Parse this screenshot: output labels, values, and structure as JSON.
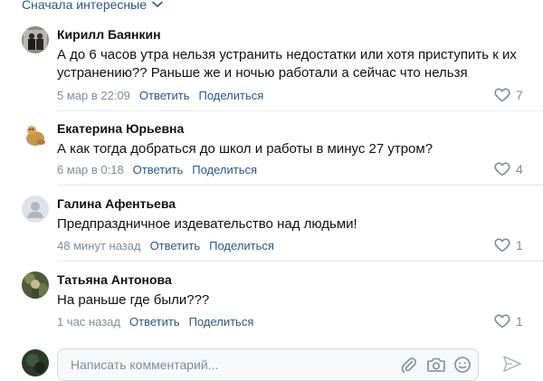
{
  "sort": {
    "label": "Сначала интересные"
  },
  "comments": [
    {
      "author": "Кирилл Баянкин",
      "text": "А до 6 часов утра нельзя устранить недостатки или хотя приступить к их устранению?? Раньше же и ночью работали а сейчас что нельзя",
      "time": "5 мар в 22:09",
      "reply_label": "Ответить",
      "share_label": "Поделиться",
      "likes": "7"
    },
    {
      "author": "Екатерина Юрьевна",
      "text": "А как тогда добраться до школ и работы в минус 27 утром?",
      "time": "6 мар в 0:18",
      "reply_label": "Ответить",
      "share_label": "Поделиться",
      "likes": "4"
    },
    {
      "author": "Галина Афентьева",
      "text": "Предпраздничное издевательство над людьми!",
      "time": "48 минут назад",
      "reply_label": "Ответить",
      "share_label": "Поделиться",
      "likes": "1"
    },
    {
      "author": "Татьяна Антонова",
      "text": "На раньше где были???",
      "time": "1 час назад",
      "reply_label": "Ответить",
      "share_label": "Поделиться",
      "likes": "1"
    }
  ],
  "compose": {
    "placeholder": "Написать комментарий...",
    "value": ""
  },
  "colors": {
    "link": "#2a5885",
    "meta": "#818c99",
    "divider": "#e7e8ec"
  },
  "icons": [
    "chevron-down-icon",
    "heart-icon",
    "paperclip-icon",
    "camera-icon",
    "emoji-icon",
    "send-icon",
    "default-avatar-icon"
  ]
}
